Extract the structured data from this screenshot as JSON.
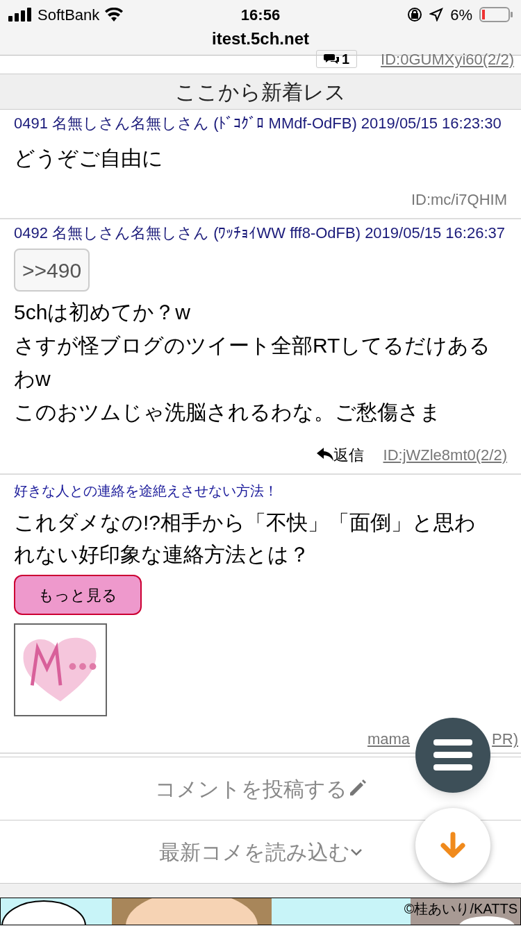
{
  "status_bar": {
    "carrier": "SoftBank",
    "time": "16:56",
    "battery": "6%",
    "url": "itest.5ch.net"
  },
  "prev_post_footer": {
    "reply_count": "1",
    "id_link": "ID:0GUMXyi60(2/2)"
  },
  "new_divider": "ここから新着レス",
  "posts": [
    {
      "header": "0491 名無しさん名無しさん (ﾄﾞｺｸﾞﾛ MMdf-OdFB) 2019/05/15 16:23:30",
      "lines": [
        "どうぞご自由に"
      ],
      "id": "ID:mc/i7QHIM",
      "id_link": false
    },
    {
      "header": "0492 名無しさん名無しさん (ﾜｯﾁｮｲWW fff8-OdFB) 2019/05/15 16:26:37",
      "quote": ">>490",
      "lines": [
        "5chは初めてか？w",
        "さすが怪ブログのツイート全部RTしてるだけあるわw",
        "このおツムじゃ洗脳されるわな。ご愁傷さま"
      ],
      "reply": "返信",
      "id": "ID:jWZle8mt0(2/2)",
      "id_link": true
    }
  ],
  "ad": {
    "title": "好きな人との連絡を途絶えさせない方法！",
    "headline": "これダメなの!?相手から「不快」「面倒」と思われない好印象な連絡方法とは？",
    "more_button": "もっと見る",
    "source_start": "mama",
    "source_end": "PR)"
  },
  "actions": [
    {
      "label": "コメントを投稿する",
      "kind": "post"
    },
    {
      "label": "最新コメを読み込む",
      "kind": "load"
    }
  ],
  "banner": {
    "credit": "©桂あいり/KATTS"
  }
}
